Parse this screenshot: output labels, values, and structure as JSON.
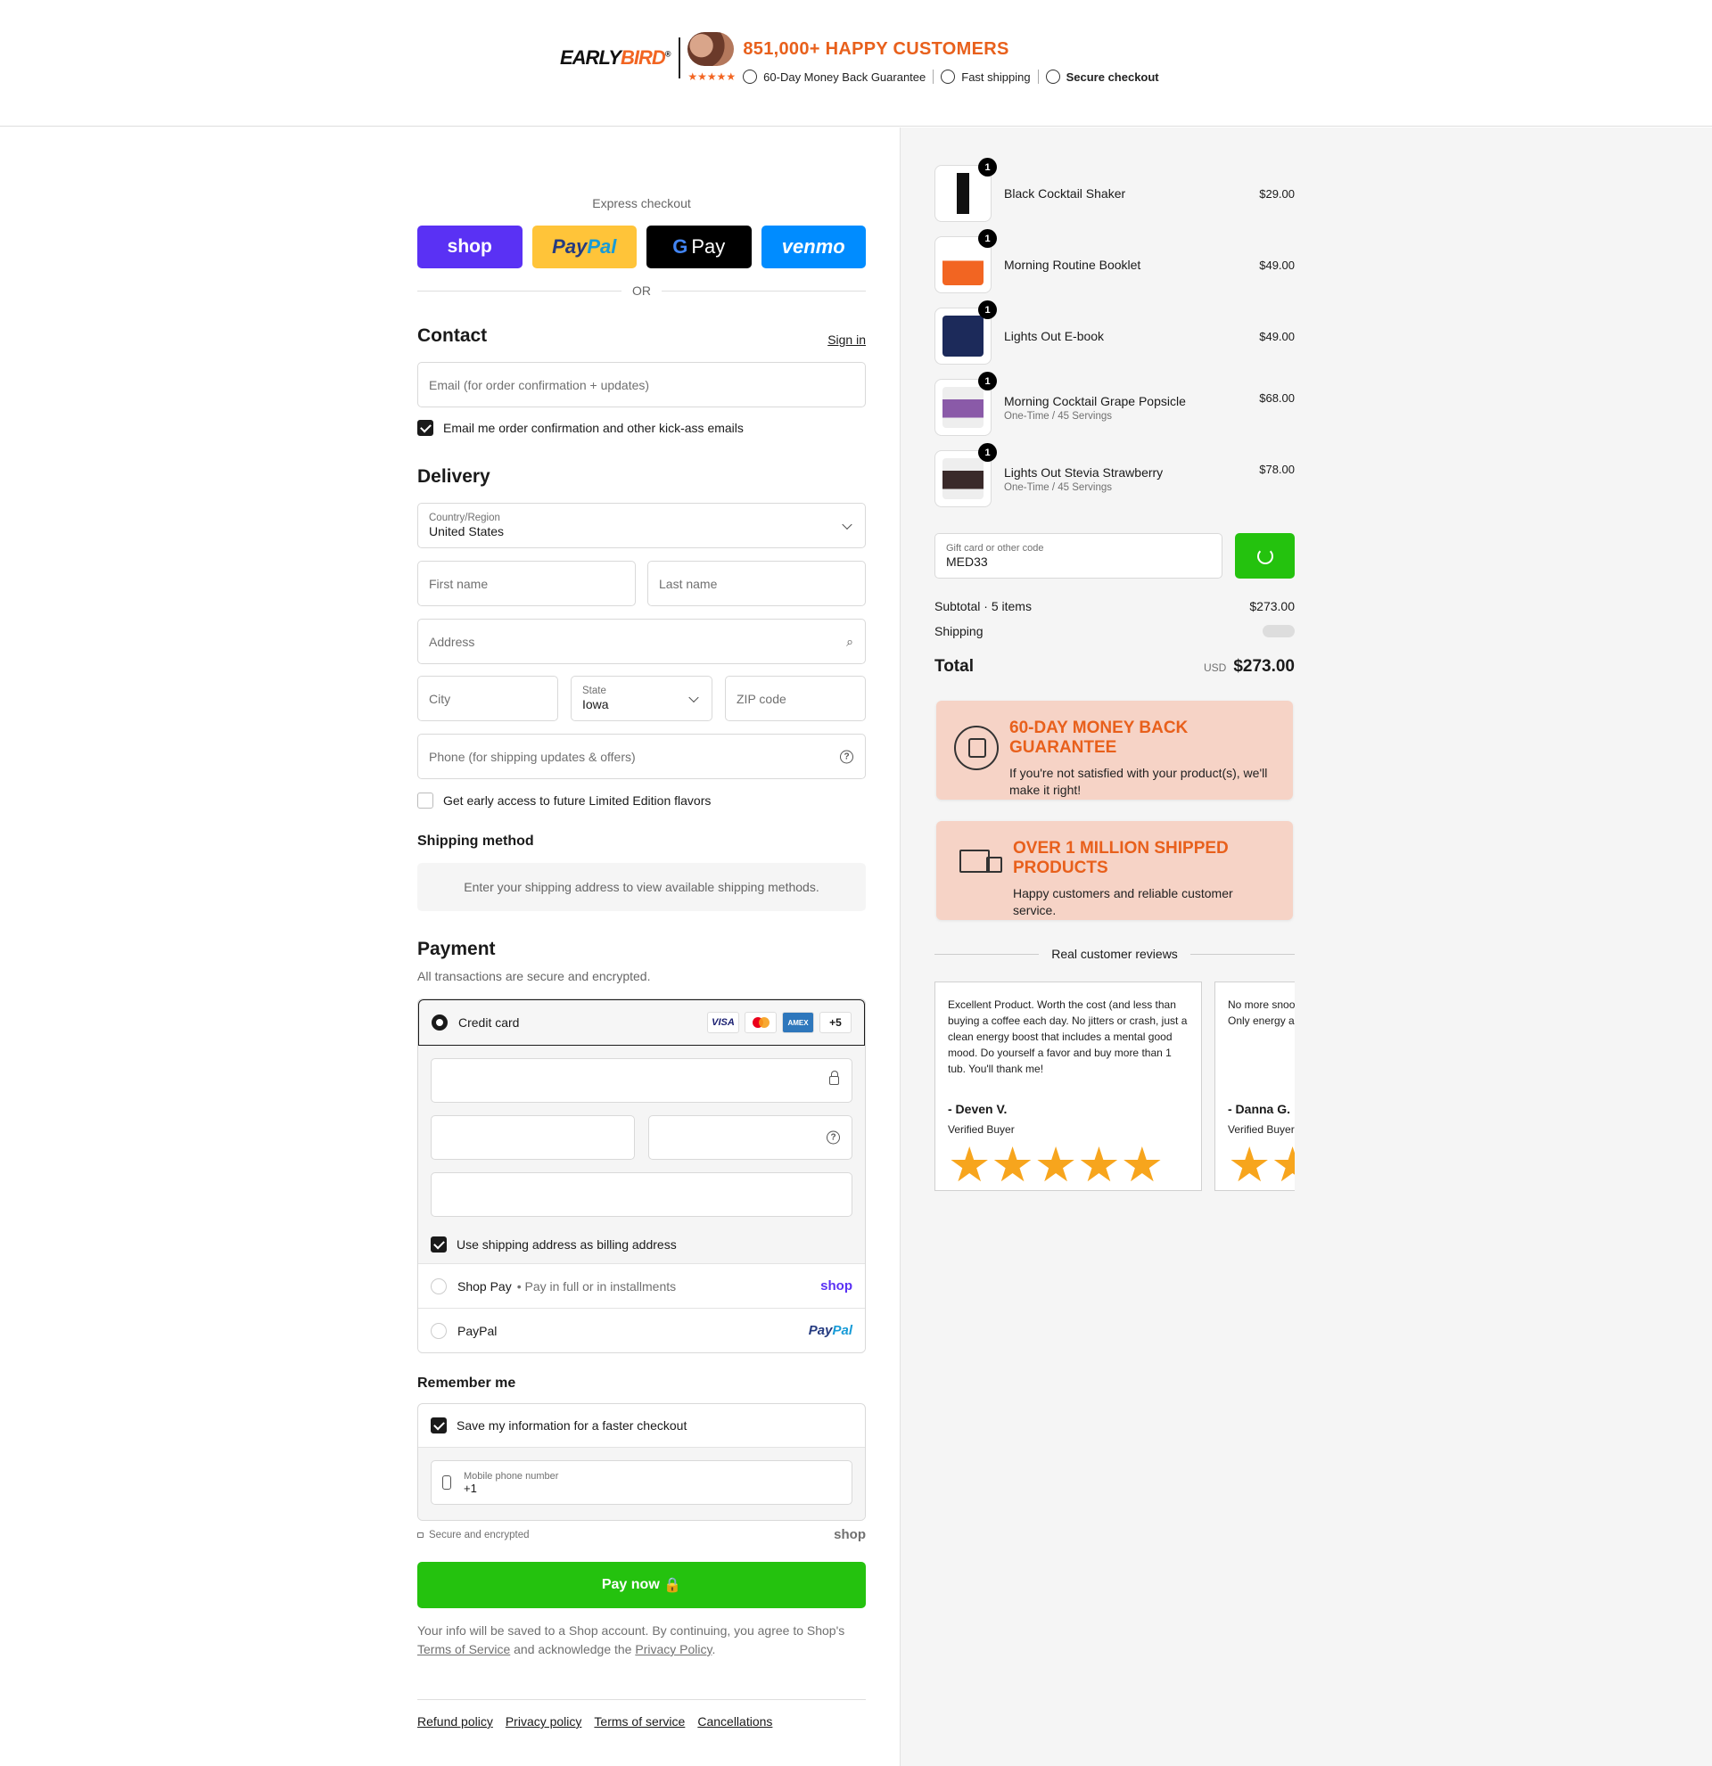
{
  "header": {
    "logo_early": "EARLY",
    "logo_bird": "BIRD",
    "customers": "851,000+ HAPPY CUSTOMERS",
    "stars": "★★★★★",
    "trust": [
      {
        "icon": "badge-icon",
        "label": "60-Day Money Back Guarantee"
      },
      {
        "icon": "stopwatch-icon",
        "label": "Fast shipping"
      },
      {
        "icon": "shield-lock-icon",
        "label": "Secure checkout"
      }
    ]
  },
  "express": {
    "label": "Express checkout",
    "shop": "shop",
    "paypal_a": "Pay",
    "paypal_b": "Pal",
    "gpay_g": "G",
    "gpay": "Pay",
    "venmo": "venmo",
    "or": "OR"
  },
  "contact": {
    "title": "Contact",
    "sign_in": "Sign in",
    "email_placeholder": "Email (for order confirmation + updates)",
    "newsletter": "Email me order confirmation and other kick-ass emails"
  },
  "delivery": {
    "title": "Delivery",
    "country_label": "Country/Region",
    "country_value": "United States",
    "first_name": "First name",
    "last_name": "Last name",
    "address": "Address",
    "city": "City",
    "state_label": "State",
    "state_value": "Iowa",
    "zip": "ZIP code",
    "phone": "Phone (for shipping updates & offers)",
    "early_access": "Get early access to future Limited Edition flavors"
  },
  "shipping_method": {
    "title": "Shipping method",
    "message": "Enter your shipping address to view available shipping methods."
  },
  "payment": {
    "title": "Payment",
    "subtitle": "All transactions are secure and encrypted.",
    "credit_card": "Credit card",
    "cards": [
      "VISA",
      "AMEX",
      "+5"
    ],
    "billing_same": "Use shipping address as billing address",
    "shop_pay": "Shop Pay",
    "shop_pay_sub": "• Pay in full or in installments",
    "shop_pay_brand": "shop",
    "paypal": "PayPal",
    "paypal_brand_a": "Pay",
    "paypal_brand_b": "Pal"
  },
  "remember": {
    "title": "Remember me",
    "save_info": "Save my information for a faster checkout",
    "mobile_label": "Mobile phone number",
    "mobile_value": "+1",
    "secure": "Secure and encrypted",
    "shop_logo": "shop"
  },
  "pay_now": "Pay now",
  "legal": {
    "text1": "Your info will be saved to a Shop account. By continuing, you agree to Shop's",
    "tos": "Terms of Service",
    "text2": "and acknowledge the",
    "privacy": "Privacy Policy",
    "text3": "."
  },
  "footer": [
    "Refund policy",
    "Privacy policy",
    "Terms of service",
    "Cancellations"
  ],
  "order": {
    "items": [
      {
        "name": "Black Cocktail Shaker",
        "variant": "",
        "price": "$29.00",
        "qty": "1",
        "color": "#111111"
      },
      {
        "name": "Morning Routine Booklet",
        "variant": "",
        "price": "$49.00",
        "qty": "1",
        "color": "#f26522"
      },
      {
        "name": "Lights Out E-book",
        "variant": "",
        "price": "$49.00",
        "qty": "1",
        "color": "#1c2a5a"
      },
      {
        "name": "Morning Cocktail Grape Popsicle",
        "variant": "One-Time / 45 Servings",
        "price": "$68.00",
        "qty": "1",
        "color": "#8a5aa8"
      },
      {
        "name": "Lights Out Stevia Strawberry",
        "variant": "One-Time / 45 Servings",
        "price": "$78.00",
        "qty": "1",
        "color": "#3a2a2a"
      }
    ],
    "code_label": "Gift card or other code",
    "code_value": "MED33",
    "subtotal_label": "Subtotal · 5 items",
    "subtotal": "$273.00",
    "shipping_label": "Shipping",
    "total_label": "Total",
    "currency": "USD",
    "total": "$273.00"
  },
  "promos": [
    {
      "title": "60-DAY MONEY BACK GUARANTEE",
      "text": "If you're not satisfied with your product(s), we'll make it right!"
    },
    {
      "title": "OVER 1 MILLION SHIPPED PRODUCTS",
      "text": "Happy customers and reliable customer service."
    }
  ],
  "reviews": {
    "title": "Real customer reviews",
    "items": [
      {
        "text": "Excellent Product. Worth the cost (and less than buying a coffee each day. No jitters or crash, just a clean energy boost that includes a mental good mood. Do yourself a favor and buy more than 1 tub. You'll thank me!",
        "author": "- Deven V.",
        "verified": "Verified Buyer",
        "stars": "★★★★★"
      },
      {
        "text": "No more snoozing, outta bed, no more brain fog!! Only energy all day!! When there is and MOVING!",
        "author": "- Danna G.",
        "verified": "Verified Buyer",
        "stars": "★★★★★"
      }
    ]
  }
}
